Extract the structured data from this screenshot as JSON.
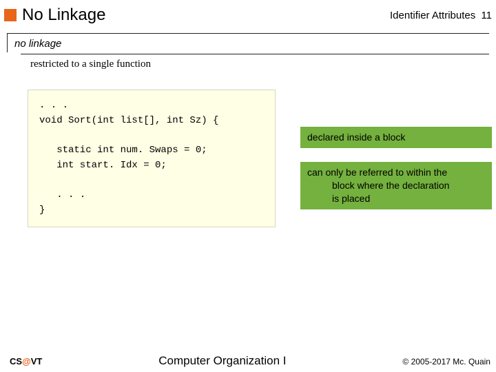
{
  "header": {
    "title": "No Linkage",
    "right_label": "Identifier Attributes",
    "page_number": "11"
  },
  "term": "no linkage",
  "definition": "restricted to a single function",
  "code": {
    "l1": ". . .",
    "l2": "void Sort(int list[], int Sz) {",
    "l3": "",
    "l4": "   static int num. Swaps = 0;",
    "l5": "   int start. Idx = 0;",
    "l6": "",
    "l7": "   . . .",
    "l8": "}"
  },
  "notes": {
    "n1": "declared inside a block",
    "n2_line1": "can only be referred to within the",
    "n2_line2": "block where the declaration",
    "n2_line3": "is placed"
  },
  "footer": {
    "left_cs": "CS",
    "left_at": "@",
    "left_vt": "VT",
    "center": "Computer Organization I",
    "right": "© 2005-2017 Mc. Quain"
  }
}
